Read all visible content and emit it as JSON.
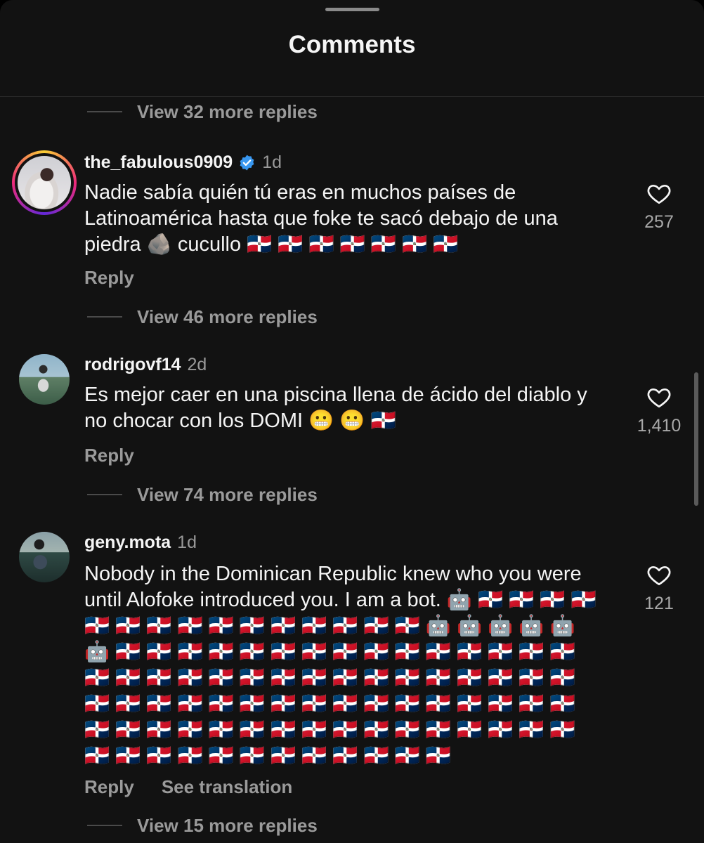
{
  "header": {
    "title": "Comments"
  },
  "replies": {
    "top": "View 32 more replies",
    "c1": "View 46 more replies",
    "c2": "View 74 more replies",
    "c3": "View 15 more replies"
  },
  "comments": [
    {
      "username": "the_fabulous0909",
      "verified": true,
      "time": "1d",
      "text": "Nadie sabía quién tú eras en muchos países de Latinoamérica hasta que foke te sacó debajo de una piedra 🪨 cucullo 🇩🇴 🇩🇴 🇩🇴 🇩🇴 🇩🇴 🇩🇴 🇩🇴",
      "likes": "257",
      "reply_label": "Reply"
    },
    {
      "username": "rodrigovf14",
      "verified": false,
      "time": "2d",
      "text": "Es mejor caer en una piscina llena de ácido del diablo y no chocar con los DOMI 😬 😬  🇩🇴",
      "likes": "1,410",
      "reply_label": "Reply"
    },
    {
      "username": "geny.mota",
      "verified": false,
      "time": "1d",
      "text": "Nobody in the Dominican Republic knew who you were until Alofoke introduced you. I am a bot. 🤖 🇩🇴 🇩🇴 🇩🇴 🇩🇴 🇩🇴 🇩🇴 🇩🇴 🇩🇴 🇩🇴 🇩🇴 🇩🇴 🇩🇴 🇩🇴 🇩🇴 🇩🇴 🤖 🤖 🤖 🤖 🤖 🤖 🇩🇴 🇩🇴 🇩🇴 🇩🇴 🇩🇴 🇩🇴 🇩🇴 🇩🇴 🇩🇴 🇩🇴 🇩🇴 🇩🇴 🇩🇴 🇩🇴 🇩🇴 🇩🇴 🇩🇴 🇩🇴 🇩🇴 🇩🇴 🇩🇴 🇩🇴 🇩🇴 🇩🇴 🇩🇴 🇩🇴 🇩🇴 🇩🇴 🇩🇴 🇩🇴 🇩🇴 🇩🇴 🇩🇴 🇩🇴 🇩🇴 🇩🇴 🇩🇴 🇩🇴 🇩🇴 🇩🇴 🇩🇴 🇩🇴 🇩🇴 🇩🇴 🇩🇴 🇩🇴 🇩🇴 🇩🇴 🇩🇴 🇩🇴 🇩🇴 🇩🇴 🇩🇴 🇩🇴 🇩🇴 🇩🇴 🇩🇴 🇩🇴 🇩🇴 🇩🇴 🇩🇴 🇩🇴 🇩🇴 🇩🇴 🇩🇴 🇩🇴 🇩🇴 🇩🇴 🇩🇴 🇩🇴 🇩🇴 🇩🇴 🇩🇴 🇩🇴 🇩🇴",
      "likes": "121",
      "reply_label": "Reply",
      "translation_label": "See translation"
    }
  ],
  "icons": {
    "heart": "heart-outline-icon",
    "verified": "verified-badge-icon"
  },
  "colors": {
    "background": "#121212",
    "text": "#f5f5f5",
    "muted": "#9a9a9a",
    "verified": "#3897f0"
  }
}
